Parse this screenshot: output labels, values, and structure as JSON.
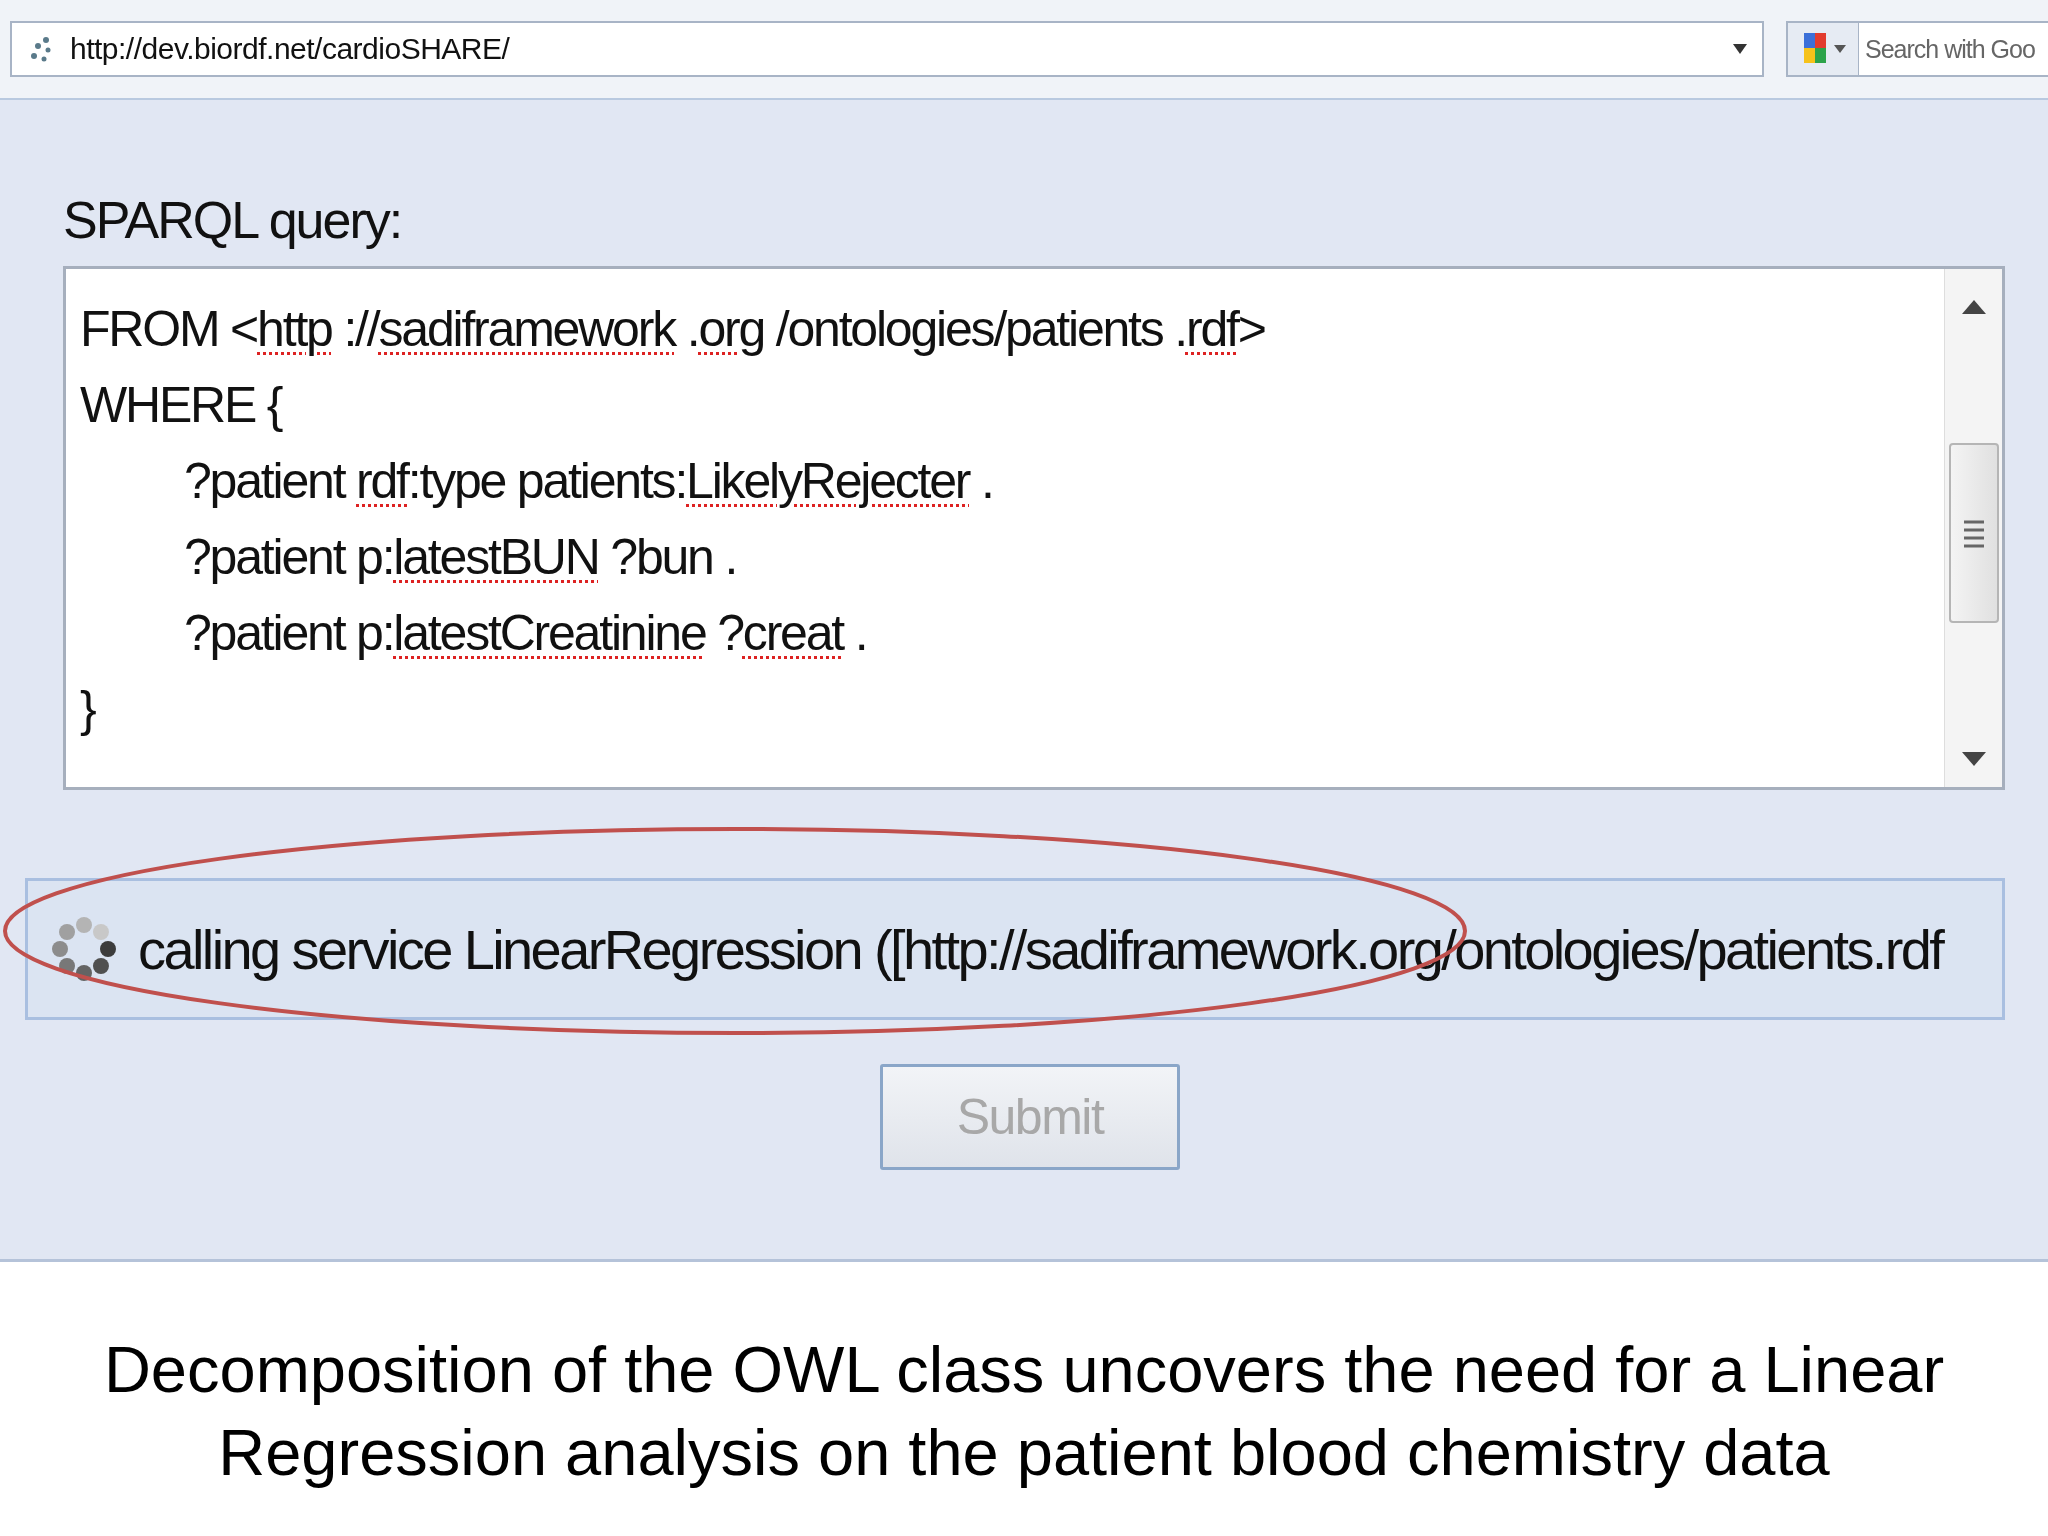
{
  "address_bar": {
    "url": "http://dev.biordf.net/cardioSHARE/",
    "search_placeholder": "Search with Goo"
  },
  "query": {
    "label": "SPARQL query:",
    "lines": [
      {
        "indent": false,
        "segments": [
          {
            "text": "FROM <",
            "misspelled": false
          },
          {
            "text": "http",
            "misspelled": true
          },
          {
            "text": " ://",
            "misspelled": false
          },
          {
            "text": "sadiframework",
            "misspelled": true
          },
          {
            "text": " .",
            "misspelled": false
          },
          {
            "text": "org",
            "misspelled": true
          },
          {
            "text": " /ontologies/patients .",
            "misspelled": false
          },
          {
            "text": "rdf",
            "misspelled": true
          },
          {
            "text": ">",
            "misspelled": false
          }
        ]
      },
      {
        "indent": false,
        "segments": [
          {
            "text": "WHERE {",
            "misspelled": false
          }
        ]
      },
      {
        "indent": true,
        "segments": [
          {
            "text": "?patient ",
            "misspelled": false
          },
          {
            "text": "rdf",
            "misspelled": true
          },
          {
            "text": ":type patients:",
            "misspelled": false
          },
          {
            "text": "LikelyRejecter",
            "misspelled": true
          },
          {
            "text": " .",
            "misspelled": false
          }
        ]
      },
      {
        "indent": true,
        "segments": [
          {
            "text": "?patient p:",
            "misspelled": false
          },
          {
            "text": "latestBUN",
            "misspelled": true
          },
          {
            "text": " ?bun .",
            "misspelled": false
          }
        ]
      },
      {
        "indent": true,
        "segments": [
          {
            "text": "?patient p:",
            "misspelled": false
          },
          {
            "text": "latestCreatinine",
            "misspelled": true
          },
          {
            "text": " ?",
            "misspelled": false
          },
          {
            "text": "creat",
            "misspelled": true
          },
          {
            "text": " .",
            "misspelled": false
          }
        ]
      },
      {
        "indent": false,
        "segments": [
          {
            "text": "}",
            "misspelled": false
          }
        ]
      }
    ]
  },
  "status": {
    "text": "calling service LinearRegression ([http://sadiframework.org/ontologies/patients.rdf",
    "highlighted": true
  },
  "submit": {
    "label": "Submit",
    "disabled": true
  },
  "caption": [
    "Decomposition of the OWL class uncovers the need for a Linear",
    "Regression analysis on the patient blood chemistry data"
  ]
}
